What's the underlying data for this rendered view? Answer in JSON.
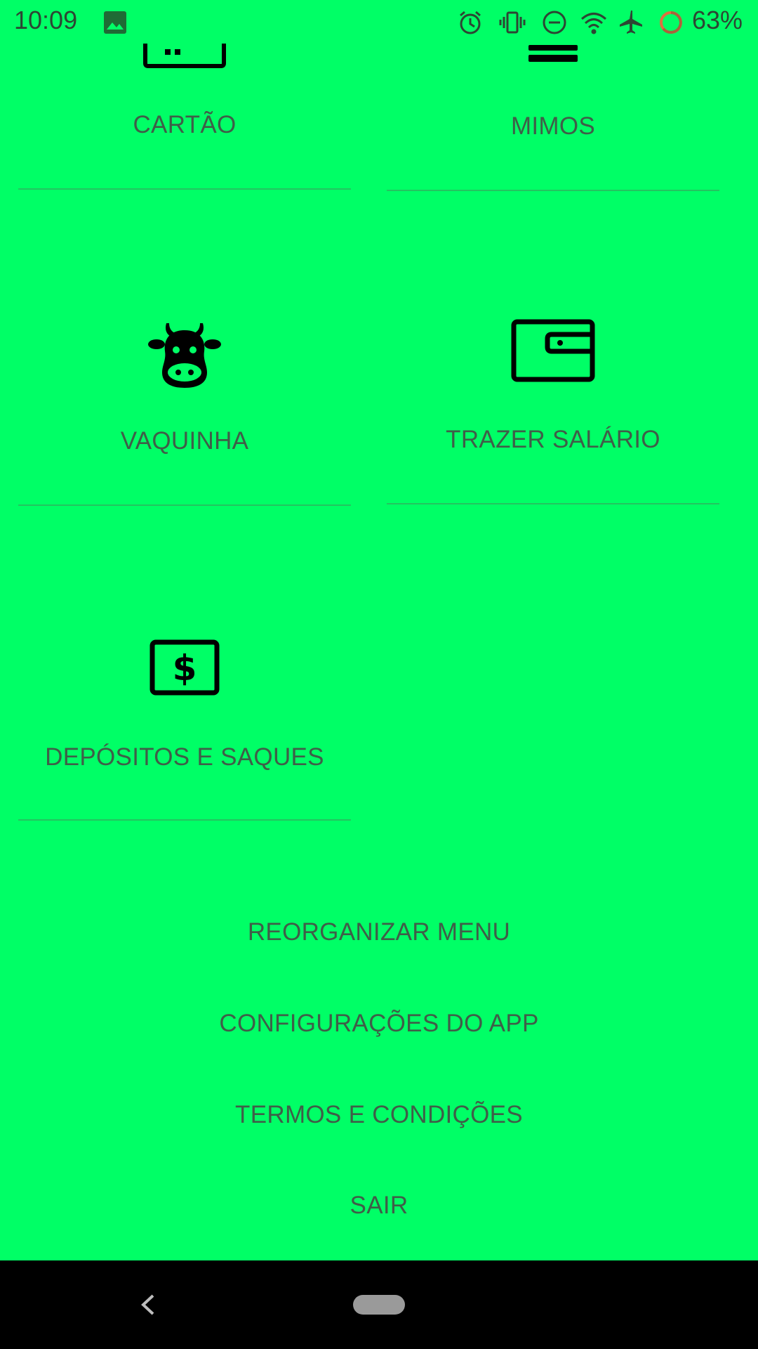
{
  "status_bar": {
    "time": "10:09",
    "battery": "63%",
    "icons": [
      "image-icon",
      "alarm-icon",
      "vibrate-icon",
      "dnd-icon",
      "wifi-icon",
      "airplane-icon",
      "battery-ring-icon"
    ]
  },
  "tiles": [
    {
      "label": "CARTÃO",
      "icon": "card-icon"
    },
    {
      "label": "MIMOS",
      "icon": "gift-icon"
    },
    {
      "label": "VAQUINHA",
      "icon": "cow-icon"
    },
    {
      "label": "TRAZER SALÁRIO",
      "icon": "wallet-icon"
    },
    {
      "label": "DEPÓSITOS E SAQUES",
      "icon": "dollar-bill-icon"
    }
  ],
  "menu": {
    "reorganize": "REORGANIZAR MENU",
    "settings": "CONFIGURAÇÕES DO APP",
    "terms": "TERMOS E CONDIÇÕES",
    "logout": "SAIR"
  },
  "colors": {
    "background": "#00FF66",
    "text": "#3f5e48",
    "nav_bar": "#000000"
  }
}
